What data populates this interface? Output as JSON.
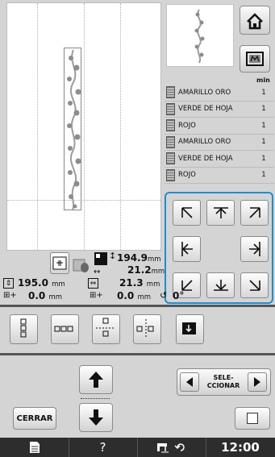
{
  "threads": {
    "header": "min",
    "items": [
      {
        "name": "AMARILLO ORO",
        "time": "1"
      },
      {
        "name": "VERDE DE HOJA",
        "time": "1"
      },
      {
        "name": "ROJO",
        "time": "1"
      },
      {
        "name": "AMARILLO ORO",
        "time": "1"
      },
      {
        "name": "VERDE DE HOJA",
        "time": "1"
      },
      {
        "name": "ROJO",
        "time": "1"
      }
    ]
  },
  "pattern_size": {
    "height": "194.9",
    "height_unit": "mm",
    "width": "21.2",
    "width_unit": "mm"
  },
  "overall_size": {
    "height": "195.0",
    "width": "21.3",
    "unit": "mm"
  },
  "offsets": {
    "vertical": "0.0",
    "horizontal": "0.0",
    "unit": "mm",
    "rotation": "0°"
  },
  "toolbar": {
    "close_label": "CERRAR",
    "select_label_line1": "SELE-",
    "select_label_line2": "CCIONAR"
  },
  "status": {
    "help": "?",
    "clock": "12:00"
  },
  "colors": {
    "accent": "#1a8fd0",
    "statusbar": "#2d2d2d",
    "leaf": "#8c8c8c"
  },
  "icons": {
    "home": "home-icon",
    "hoop": "embroidery-frame-icon",
    "up": "arrow-up-icon",
    "down": "arrow-down-icon",
    "select_prev": "triangle-left-icon",
    "select_next": "triangle-right-icon"
  }
}
